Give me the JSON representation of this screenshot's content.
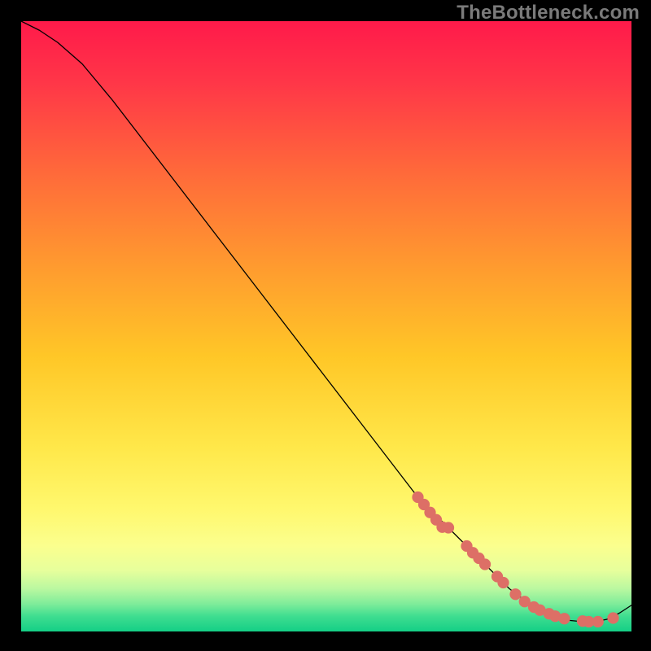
{
  "watermark": "TheBottleneck.com",
  "chart_data": {
    "type": "line",
    "title": "",
    "xlabel": "",
    "ylabel": "",
    "xlim": [
      0,
      100
    ],
    "ylim": [
      0,
      100
    ],
    "series": [
      {
        "name": "curve",
        "x": [
          0,
          3,
          6,
          10,
          15,
          20,
          25,
          30,
          35,
          40,
          45,
          50,
          55,
          60,
          65,
          70,
          73,
          76,
          78,
          80,
          82,
          84,
          86,
          88,
          90,
          92,
          94,
          96,
          98,
          100
        ],
        "y": [
          100,
          98.5,
          96.5,
          93,
          87,
          80.5,
          74,
          67.5,
          61,
          54.5,
          48,
          41.5,
          35,
          28.5,
          22,
          17,
          14,
          11,
          9,
          7,
          5.5,
          4,
          3,
          2.2,
          1.8,
          1.6,
          1.6,
          2.0,
          3.0,
          4.3
        ]
      }
    ],
    "markers": {
      "name": "dots",
      "color": "#dd6f66",
      "x": [
        65,
        66,
        67,
        68,
        69,
        70,
        73,
        74,
        75,
        76,
        78,
        79,
        81,
        82.5,
        84,
        85,
        86.5,
        87.5,
        89,
        92,
        93,
        94.5,
        97
      ],
      "y": [
        22,
        20.8,
        19.5,
        18.3,
        17.1,
        17,
        14,
        12.9,
        12,
        11,
        9,
        8,
        6.1,
        4.9,
        4,
        3.5,
        2.9,
        2.5,
        2.1,
        1.7,
        1.6,
        1.6,
        2.2
      ]
    },
    "background_gradient": {
      "stops": [
        {
          "pos": 0.0,
          "color": "#ff1a4a"
        },
        {
          "pos": 0.1,
          "color": "#ff3648"
        },
        {
          "pos": 0.25,
          "color": "#ff6a3a"
        },
        {
          "pos": 0.4,
          "color": "#ff9a2f"
        },
        {
          "pos": 0.55,
          "color": "#ffc727"
        },
        {
          "pos": 0.7,
          "color": "#ffe84a"
        },
        {
          "pos": 0.8,
          "color": "#fff86e"
        },
        {
          "pos": 0.86,
          "color": "#fbff8e"
        },
        {
          "pos": 0.9,
          "color": "#e7ff9c"
        },
        {
          "pos": 0.93,
          "color": "#baf8a0"
        },
        {
          "pos": 0.955,
          "color": "#7eec9a"
        },
        {
          "pos": 0.975,
          "color": "#3fdd90"
        },
        {
          "pos": 1.0,
          "color": "#14cf86"
        }
      ]
    }
  }
}
